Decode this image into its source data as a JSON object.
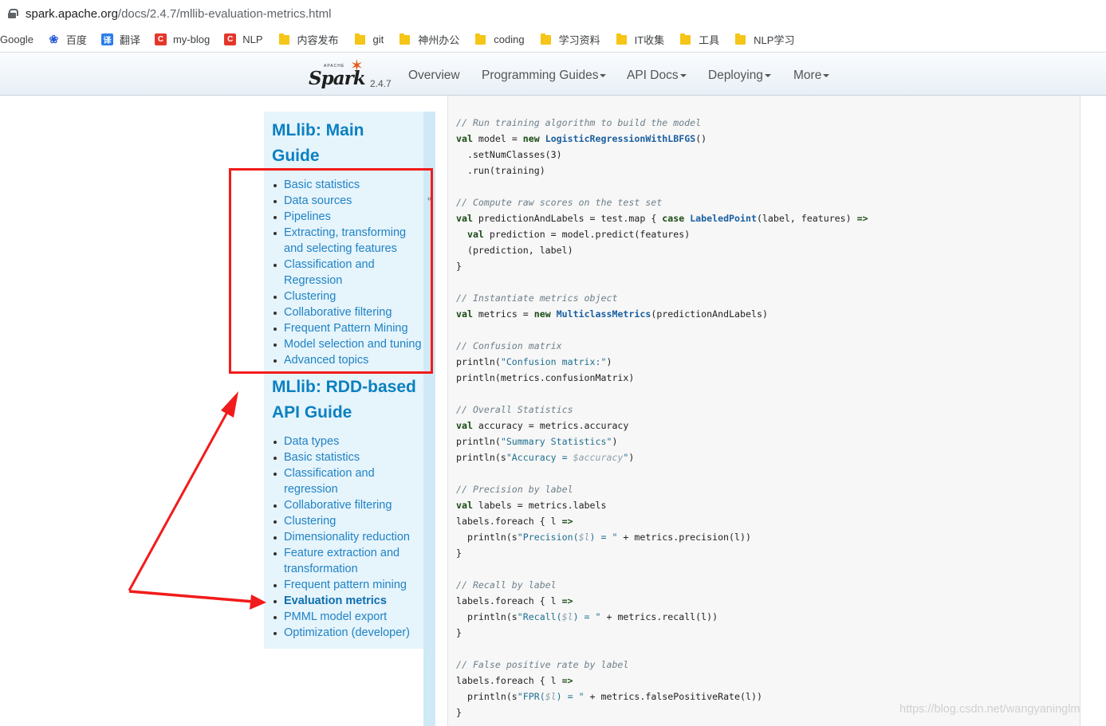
{
  "browser": {
    "url_host": "spark.apache.org",
    "url_path": "/docs/2.4.7/mllib-evaluation-metrics.html"
  },
  "bookmarks": [
    {
      "label": "Google",
      "icon": "none"
    },
    {
      "label": "百度",
      "icon": "baidu-paw-icon"
    },
    {
      "label": "翻译",
      "icon": "translate-icon"
    },
    {
      "label": "my-blog",
      "icon": "csdn-icon"
    },
    {
      "label": "NLP",
      "icon": "csdn-icon"
    },
    {
      "label": "内容发布",
      "icon": "folder-icon"
    },
    {
      "label": "git",
      "icon": "folder-icon"
    },
    {
      "label": "神州办公",
      "icon": "folder-icon"
    },
    {
      "label": "coding",
      "icon": "folder-icon"
    },
    {
      "label": "学习资料",
      "icon": "folder-icon"
    },
    {
      "label": "IT收集",
      "icon": "folder-icon"
    },
    {
      "label": "工具",
      "icon": "folder-icon"
    },
    {
      "label": "NLP学习",
      "icon": "folder-icon"
    }
  ],
  "navbar": {
    "logo_small": "APACHE",
    "logo_word": "Spark",
    "version": "2.4.7",
    "links": [
      "Overview",
      "Programming Guides",
      "API Docs",
      "Deploying",
      "More"
    ]
  },
  "sidebar": {
    "main_title_line1": "MLlib: Main",
    "main_title_line2": "Guide",
    "main_items": [
      [
        "Basic statistics"
      ],
      [
        "Data sources"
      ],
      [
        "Pipelines"
      ],
      [
        "Extracting, transforming",
        "and selecting features"
      ],
      [
        "Classification and",
        "Regression"
      ],
      [
        "Clustering"
      ],
      [
        "Collaborative filtering"
      ],
      [
        "Frequent Pattern Mining"
      ],
      [
        "Model selection and tuning"
      ],
      [
        "Advanced topics"
      ]
    ],
    "rdd_title_line1": "MLlib: RDD-based",
    "rdd_title_line2": "API Guide",
    "rdd_items": [
      [
        "Data types"
      ],
      [
        "Basic statistics"
      ],
      [
        "Classification and",
        "regression"
      ],
      [
        "Collaborative filtering"
      ],
      [
        "Clustering"
      ],
      [
        "Dimensionality reduction"
      ],
      [
        "Feature extraction and",
        "transformation"
      ],
      [
        "Frequent pattern mining"
      ],
      [
        "Evaluation metrics"
      ],
      [
        "PMML model export"
      ],
      [
        "Optimization (developer)"
      ]
    ],
    "active_item": "Evaluation metrics"
  },
  "code_lines": [
    [
      [
        "cm",
        "// Run training algorithm to build the model"
      ]
    ],
    [
      [
        "kw",
        "val"
      ],
      [
        "",
        " model = "
      ],
      [
        "kw",
        "new"
      ],
      [
        "",
        " "
      ],
      [
        "ty",
        "LogisticRegressionWithLBFGS"
      ],
      [
        "",
        "()"
      ]
    ],
    [
      [
        "",
        "  .setNumClasses(3)"
      ]
    ],
    [
      [
        "",
        "  .run(training)"
      ]
    ],
    [],
    [
      [
        "cm",
        "// Compute raw scores on the test set"
      ]
    ],
    [
      [
        "kw",
        "val"
      ],
      [
        "",
        " predictionAndLabels = test.map { "
      ],
      [
        "kw",
        "case"
      ],
      [
        "",
        " "
      ],
      [
        "ty",
        "LabeledPoint"
      ],
      [
        "",
        "(label, features) "
      ],
      [
        "kw",
        "=>"
      ]
    ],
    [
      [
        "",
        "  "
      ],
      [
        "kw",
        "val"
      ],
      [
        "",
        " prediction = model.predict(features)"
      ]
    ],
    [
      [
        "",
        "  (prediction, label)"
      ]
    ],
    [
      [
        "",
        "}"
      ]
    ],
    [],
    [
      [
        "cm",
        "// Instantiate metrics object"
      ]
    ],
    [
      [
        "kw",
        "val"
      ],
      [
        "",
        " metrics = "
      ],
      [
        "kw",
        "new"
      ],
      [
        "",
        " "
      ],
      [
        "ty",
        "MulticlassMetrics"
      ],
      [
        "",
        "(predictionAndLabels)"
      ]
    ],
    [],
    [
      [
        "cm",
        "// Confusion matrix"
      ]
    ],
    [
      [
        "",
        "println("
      ],
      [
        "st",
        "\"Confusion matrix:\""
      ],
      [
        "",
        ")"
      ]
    ],
    [
      [
        "",
        "println(metrics.confusionMatrix)"
      ]
    ],
    [],
    [
      [
        "cm",
        "// Overall Statistics"
      ]
    ],
    [
      [
        "kw",
        "val"
      ],
      [
        "",
        " accuracy = metrics.accuracy"
      ]
    ],
    [
      [
        "",
        "println("
      ],
      [
        "st",
        "\"Summary Statistics\""
      ],
      [
        "",
        ")"
      ]
    ],
    [
      [
        "",
        "println(s"
      ],
      [
        "st",
        "\"Accuracy = "
      ],
      [
        "ip",
        "$accuracy"
      ],
      [
        "st",
        "\""
      ],
      [
        "",
        ")"
      ]
    ],
    [],
    [
      [
        "cm",
        "// Precision by label"
      ]
    ],
    [
      [
        "kw",
        "val"
      ],
      [
        "",
        " labels = metrics.labels"
      ]
    ],
    [
      [
        "",
        "labels.foreach { l "
      ],
      [
        "kw",
        "=>"
      ]
    ],
    [
      [
        "",
        "  println(s"
      ],
      [
        "st",
        "\"Precision("
      ],
      [
        "ip",
        "$l"
      ],
      [
        "st",
        ") = \""
      ],
      [
        "",
        " + metrics.precision(l))"
      ]
    ],
    [
      [
        "",
        "}"
      ]
    ],
    [],
    [
      [
        "cm",
        "// Recall by label"
      ]
    ],
    [
      [
        "",
        "labels.foreach { l "
      ],
      [
        "kw",
        "=>"
      ]
    ],
    [
      [
        "",
        "  println(s"
      ],
      [
        "st",
        "\"Recall("
      ],
      [
        "ip",
        "$l"
      ],
      [
        "st",
        ") = \""
      ],
      [
        "",
        " + metrics.recall(l))"
      ]
    ],
    [
      [
        "",
        "}"
      ]
    ],
    [],
    [
      [
        "cm",
        "// False positive rate by label"
      ]
    ],
    [
      [
        "",
        "labels.foreach { l "
      ],
      [
        "kw",
        "=>"
      ]
    ],
    [
      [
        "",
        "  println(s"
      ],
      [
        "st",
        "\"FPR("
      ],
      [
        "ip",
        "$l"
      ],
      [
        "st",
        ") = \""
      ],
      [
        "",
        " + metrics.falsePositiveRate(l))"
      ]
    ],
    [
      [
        "",
        "}"
      ]
    ]
  ],
  "watermark": "https://blog.csdn.net/wangyaninglm",
  "annotation_color": "#f21b1b"
}
